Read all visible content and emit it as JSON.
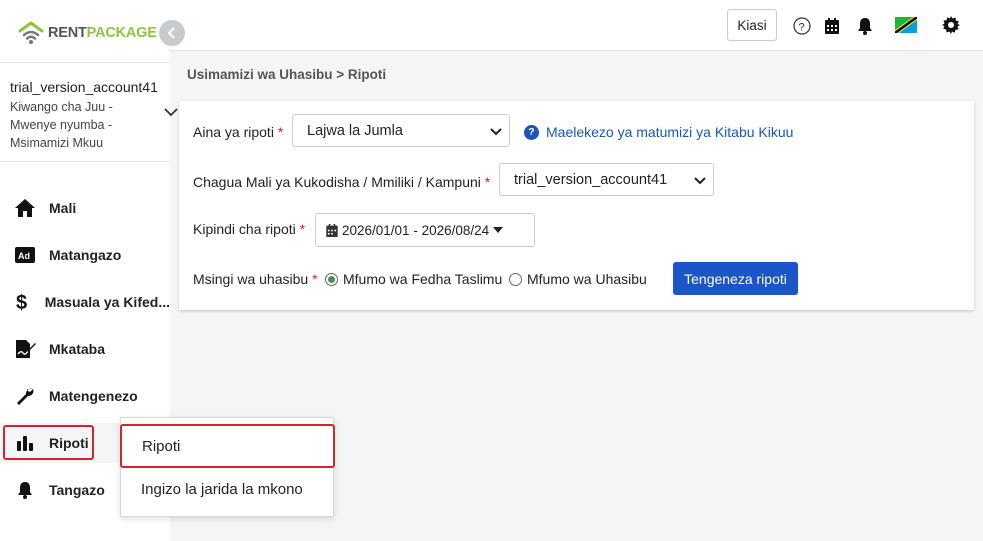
{
  "brand": {
    "logo_rent": "RENT",
    "logo_package": "PACKAGE",
    "accent": "#8cc63f"
  },
  "account": {
    "name": "trial_version_account41",
    "role_line1": "Kiwango cha Juu -",
    "role_line2": "Mwenye nyumba -",
    "role_line3": "Msimamizi Mkuu"
  },
  "sidebar": {
    "items": [
      {
        "label": "Mali",
        "icon": "home-icon"
      },
      {
        "label": "Matangazo",
        "icon": "ad-icon"
      },
      {
        "label": "Masuala ya Kifed...",
        "icon": "dollar-icon"
      },
      {
        "label": "Mkataba",
        "icon": "contract-icon"
      },
      {
        "label": "Matengenezo",
        "icon": "wrench-icon"
      },
      {
        "label": "Ripoti",
        "icon": "bar-chart-icon"
      },
      {
        "label": "Tangazo",
        "icon": "bell-icon"
      }
    ]
  },
  "topbar": {
    "kiasi_label": "Kiasi"
  },
  "breadcrumb": "Usimamizi wa Uhasibu > Ripoti",
  "form": {
    "report_type_label": "Aina ya ripoti",
    "report_type_value": "Lajwa la Jumla",
    "help_link": "Maelekezo ya matumizi ya Kitabu Kikuu",
    "property_label": "Chagua Mali ya Kukodisha / Mmiliki / Kampuni",
    "property_value": "trial_version_account41",
    "period_label": "Kipindi cha ripoti",
    "period_value": "2026/01/01 - 2026/08/24",
    "basis_label": "Msingi wa uhasibu",
    "basis_option1": "Mfumo wa Fedha Taslimu",
    "basis_option2": "Mfumo wa Uhasibu",
    "required_mark": "*",
    "generate_button": "Tengeneza ripoti"
  },
  "submenu": {
    "item1": "Ripoti",
    "item2": "Ingizo la jarida la mkono"
  },
  "colors": {
    "primary_button": "#1a56c8",
    "highlight_border": "#d0262b",
    "link": "#1a56b8"
  }
}
